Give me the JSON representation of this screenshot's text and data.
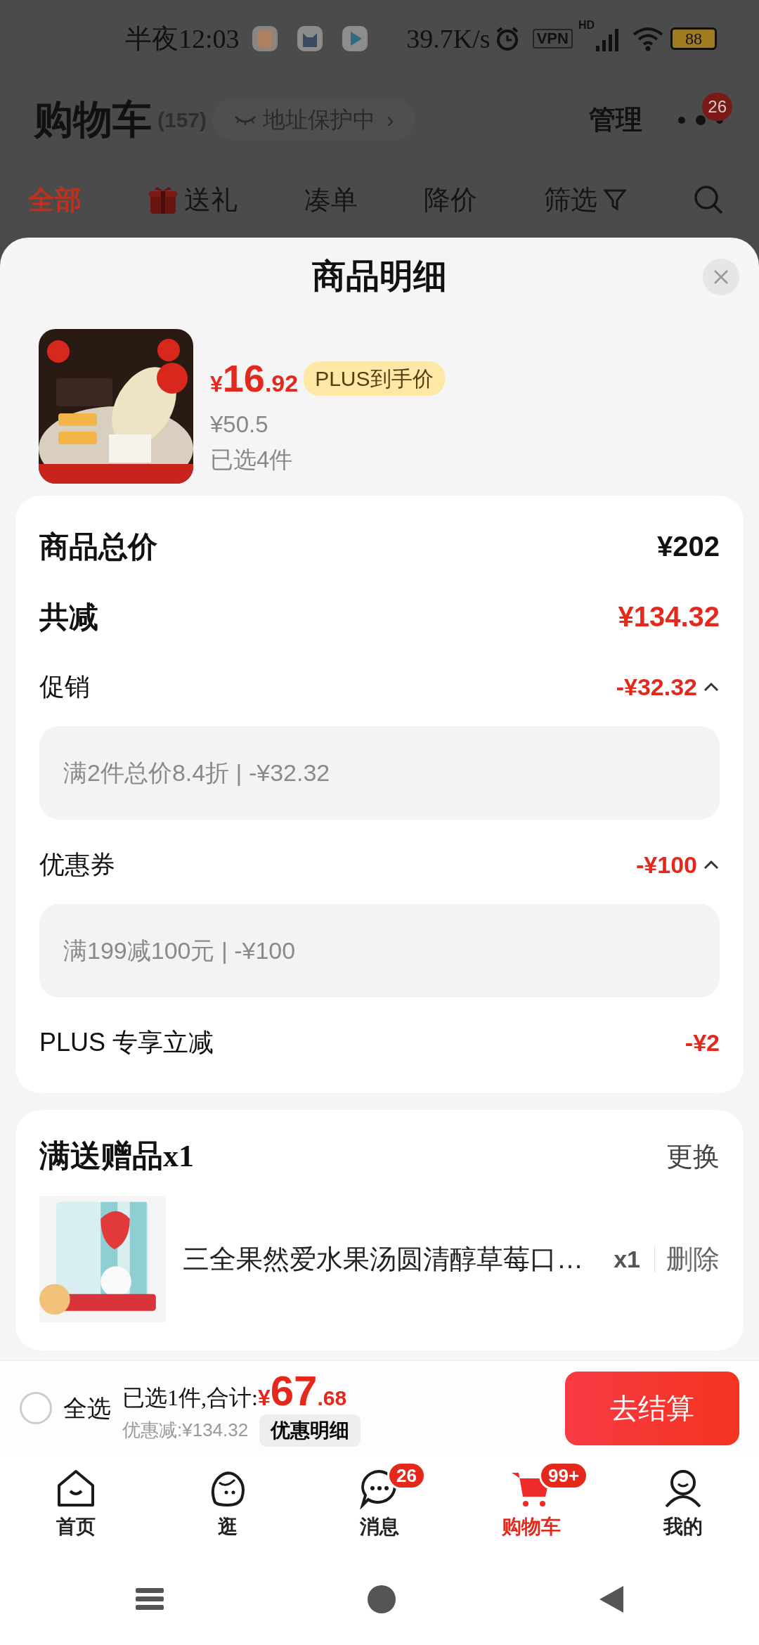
{
  "status_bar": {
    "time": "半夜12:03",
    "net_speed": "39.7K/s",
    "vpn": "VPN",
    "signal_tag": "HD",
    "battery": "88"
  },
  "header": {
    "title": "购物车",
    "count": "(157)",
    "address_pill": "地址保护中",
    "address_arrow": "›",
    "manage": "管理",
    "badge": "26"
  },
  "filter_tabs": [
    {
      "label": "全部",
      "selected": true,
      "kind": "plain"
    },
    {
      "label": "送礼",
      "selected": false,
      "kind": "gift"
    },
    {
      "label": "凑单",
      "selected": false,
      "kind": "plain"
    },
    {
      "label": "降价",
      "selected": false,
      "kind": "plain"
    },
    {
      "label": "筛选",
      "selected": false,
      "kind": "filter"
    }
  ],
  "sheet": {
    "title": "商品明细",
    "product": {
      "kind": "picture",
      "currency": "¥",
      "price_int": "16",
      "price_dec": ".92",
      "tag": "PLUS到手价",
      "original_price": "¥50.5",
      "selected_count": "已选4件"
    },
    "summary": [
      {
        "kind": "total",
        "label": "商品总价",
        "value": "¥202"
      },
      {
        "kind": "reduction",
        "label": "共减",
        "value": "¥134.32"
      },
      {
        "kind": "expandable",
        "label": "促销",
        "value": "-¥32.32",
        "expanded": true,
        "detail": "满2件总价8.4折 | -¥32.32"
      },
      {
        "kind": "expandable",
        "label": "优惠券",
        "value": "-¥100",
        "expanded": true,
        "detail": "满199减100元 | -¥100"
      },
      {
        "kind": "plain",
        "label": "PLUS 专享立减",
        "value": "-¥2"
      }
    ],
    "gift": {
      "title": "满送赠品x1",
      "action": "更换",
      "items": [
        {
          "kind": "picture",
          "name": "三全果然爱水果汤圆清醇草莓口…",
          "qty": "x1",
          "action": "删除"
        }
      ]
    }
  },
  "checkout": {
    "checked": false,
    "select_all": "全选",
    "summary": "已选1件,合计:",
    "currency": "¥",
    "total_int": "67",
    "total_dec": ".68",
    "saving": "优惠减:¥134.32",
    "details_button": "优惠明细",
    "submit": "去结算"
  },
  "tabbar": [
    {
      "kind": "home",
      "label": "首页",
      "selected": false
    },
    {
      "kind": "explore",
      "label": "逛",
      "selected": false
    },
    {
      "kind": "message",
      "label": "消息",
      "selected": false,
      "badge": "26"
    },
    {
      "kind": "cart",
      "label": "购物车",
      "selected": true,
      "badge": "99+"
    },
    {
      "kind": "me",
      "label": "我的",
      "selected": false
    }
  ]
}
